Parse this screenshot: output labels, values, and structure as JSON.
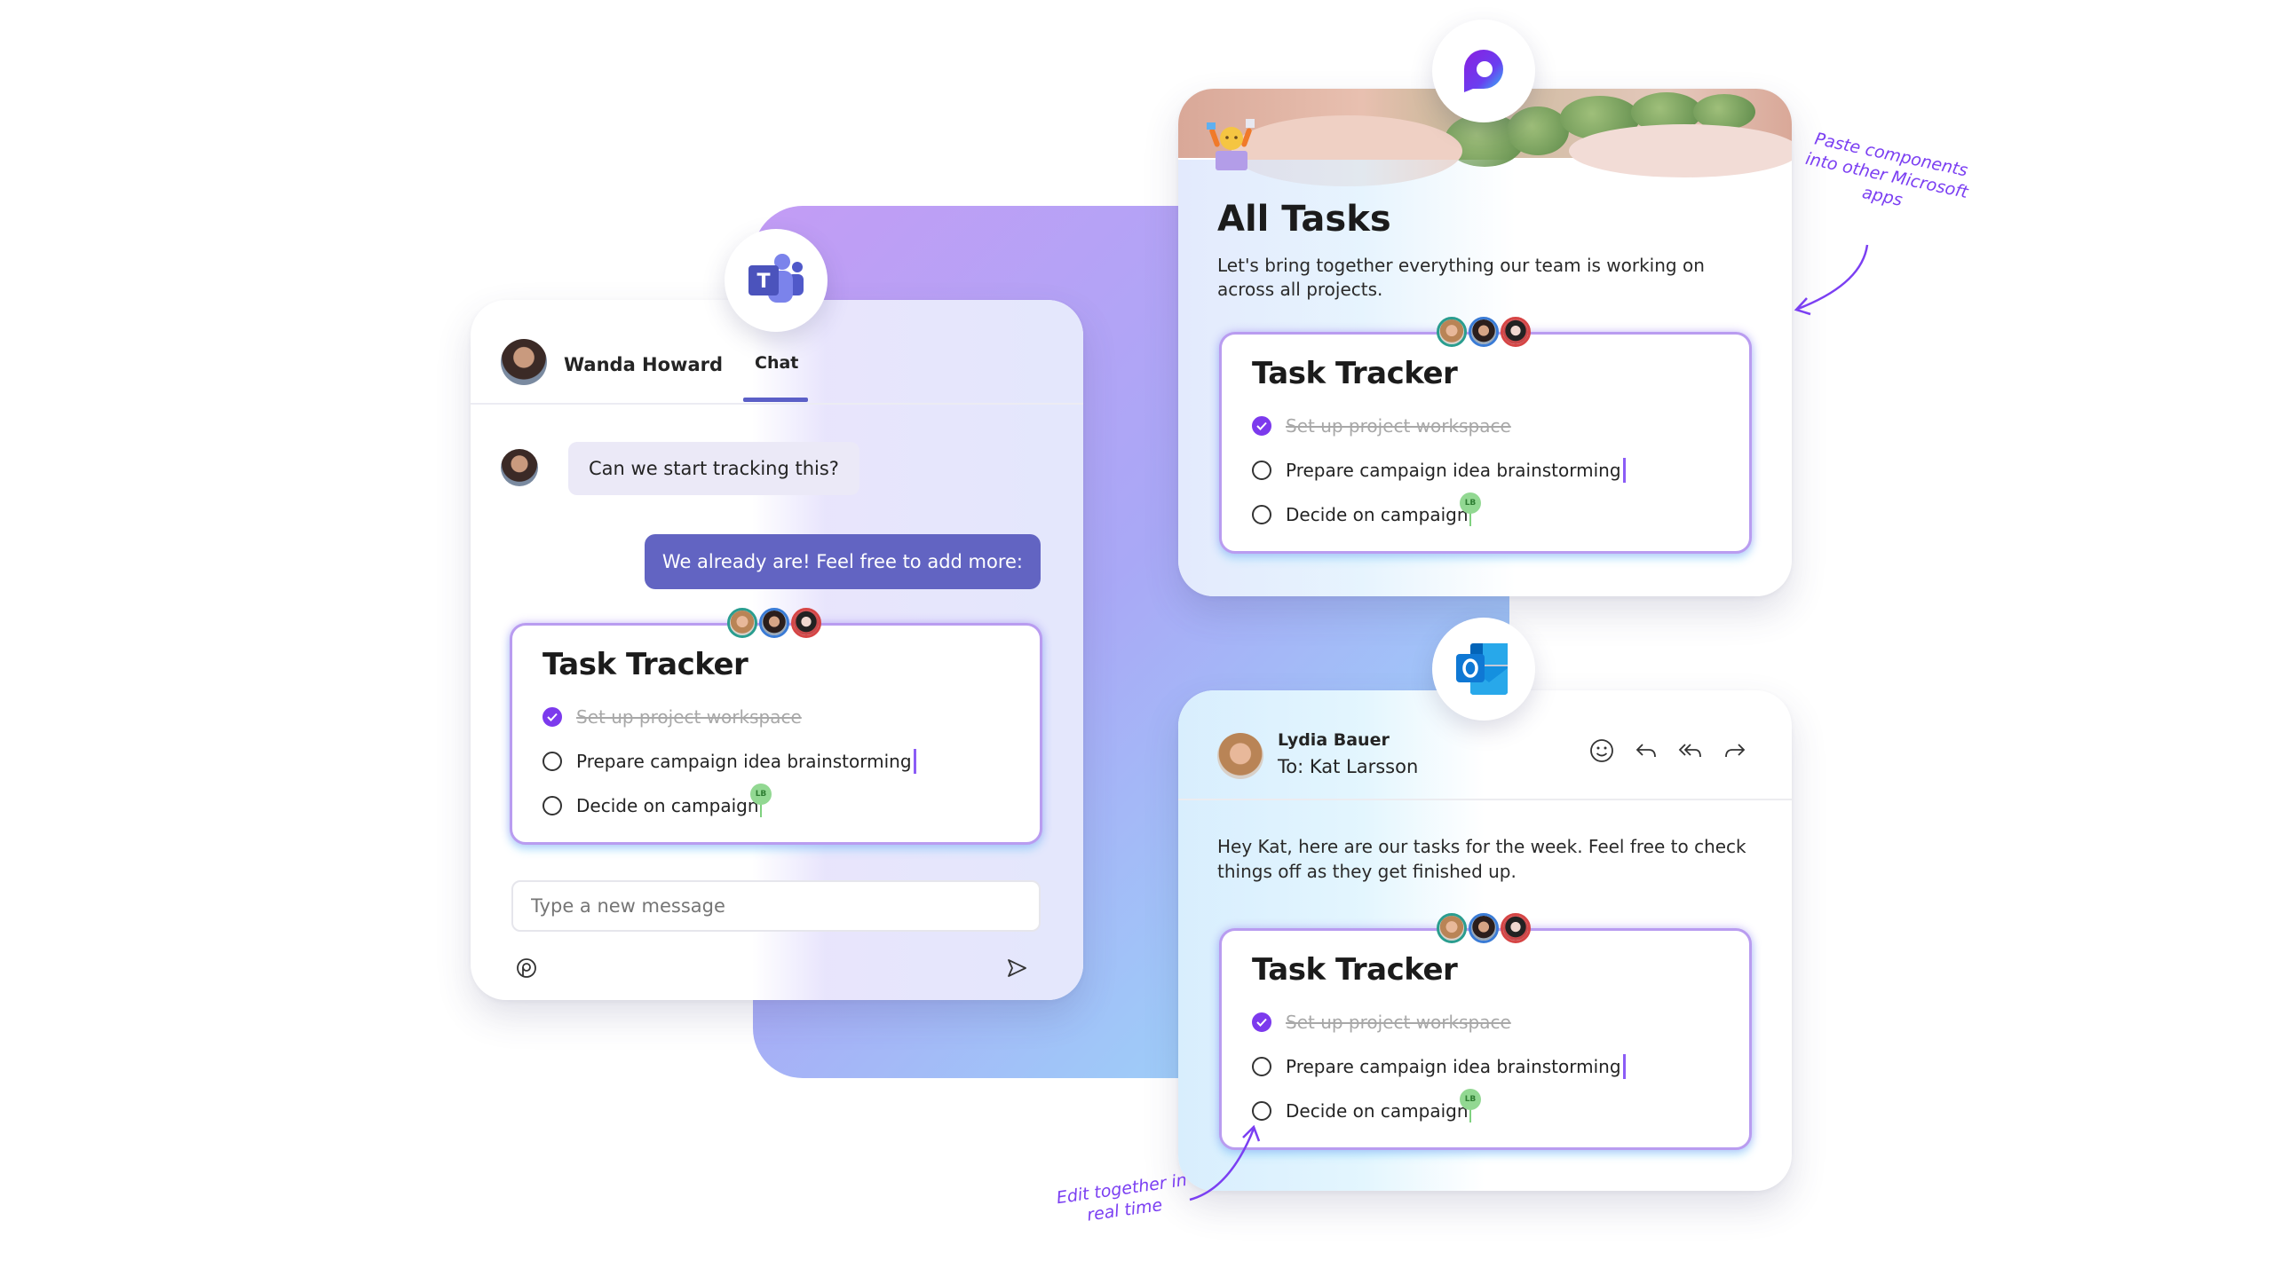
{
  "colors": {
    "teams_purple": "#5b5fc7",
    "bubble_out": "#6264c2",
    "check_purple": "#7c3aed",
    "annotation_purple": "#7b3ff2",
    "lb_green": "#92d892"
  },
  "teams_chat": {
    "app_icon": "microsoft-teams-icon",
    "contact_name": "Wanda Howard",
    "active_tab": "Chat",
    "messages": [
      {
        "direction": "incoming",
        "text": "Can we start tracking this?"
      },
      {
        "direction": "outgoing",
        "text": "We already are! Feel free to add more:"
      }
    ],
    "compose_placeholder": "Type a new message",
    "compose_icons": [
      "loop-component-icon",
      "send-icon"
    ]
  },
  "task_tracker": {
    "title": "Task Tracker",
    "presence_avatars": [
      "teal-ring",
      "blue-ring",
      "red-ring"
    ],
    "tasks": [
      {
        "label": "Set up project workspace",
        "done": true
      },
      {
        "label": "Prepare campaign idea brainstorming",
        "done": false,
        "cursor": "active"
      },
      {
        "label": "Decide on campaign",
        "done": false,
        "cursor": "LB"
      }
    ],
    "collaborator_badge": "LB"
  },
  "loop_page": {
    "app_icon": "microsoft-loop-icon",
    "title": "All Tasks",
    "description": "Let's bring together everything our team is working on across all projects."
  },
  "outlook_mail": {
    "app_icon": "microsoft-outlook-icon",
    "sender": "Lydia Bauer",
    "recipient": "To: Kat Larsson",
    "actions": [
      "emoji-react-icon",
      "reply-icon",
      "reply-all-icon",
      "forward-icon"
    ],
    "body": "Hey Kat, here are our tasks for the week. Feel free to check things off as they get finished up."
  },
  "annotations": {
    "paste": "Paste components into other Microsoft apps",
    "paste_lines": [
      "Paste components",
      "into other Microsoft",
      "apps"
    ],
    "edit_lines": [
      "Edit together in",
      "real time"
    ]
  }
}
